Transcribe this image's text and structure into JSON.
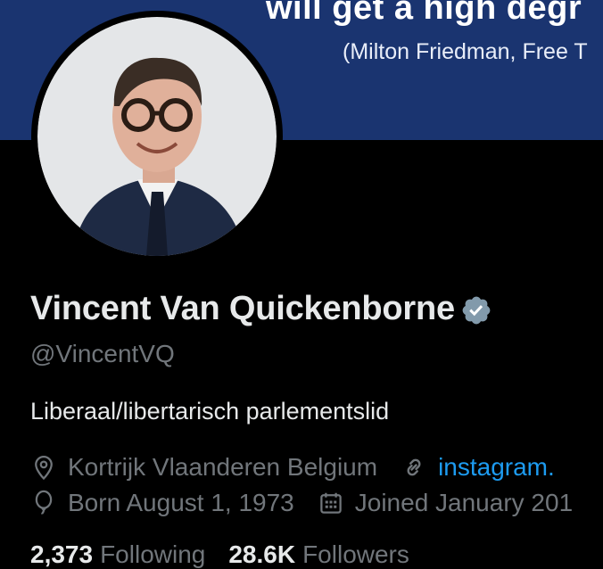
{
  "banner": {
    "quote": "will get a high degr",
    "attribution": "(Milton Friedman, Free T"
  },
  "profile": {
    "display_name": "Vincent Van Quickenborne",
    "handle": "@VincentVQ",
    "bio": "Liberaal/libertarisch parlementslid",
    "location": "Kortrijk Vlaanderen Belgium",
    "website": "instagram.",
    "birthday": "Born August 1, 1973",
    "joined": "Joined January 201",
    "following_count": "2,373",
    "following_label": "Following",
    "followers_count": "28.6K",
    "followers_label": "Followers"
  },
  "icons": [
    "verified-badge-icon",
    "location-pin-icon",
    "link-icon",
    "balloon-icon",
    "calendar-icon"
  ],
  "colors": {
    "background": "#000000",
    "banner": "#1a3470",
    "primary_text": "#e7e9ea",
    "secondary_text": "#71767b",
    "link": "#1d9bf0",
    "verified": "#829aab"
  }
}
